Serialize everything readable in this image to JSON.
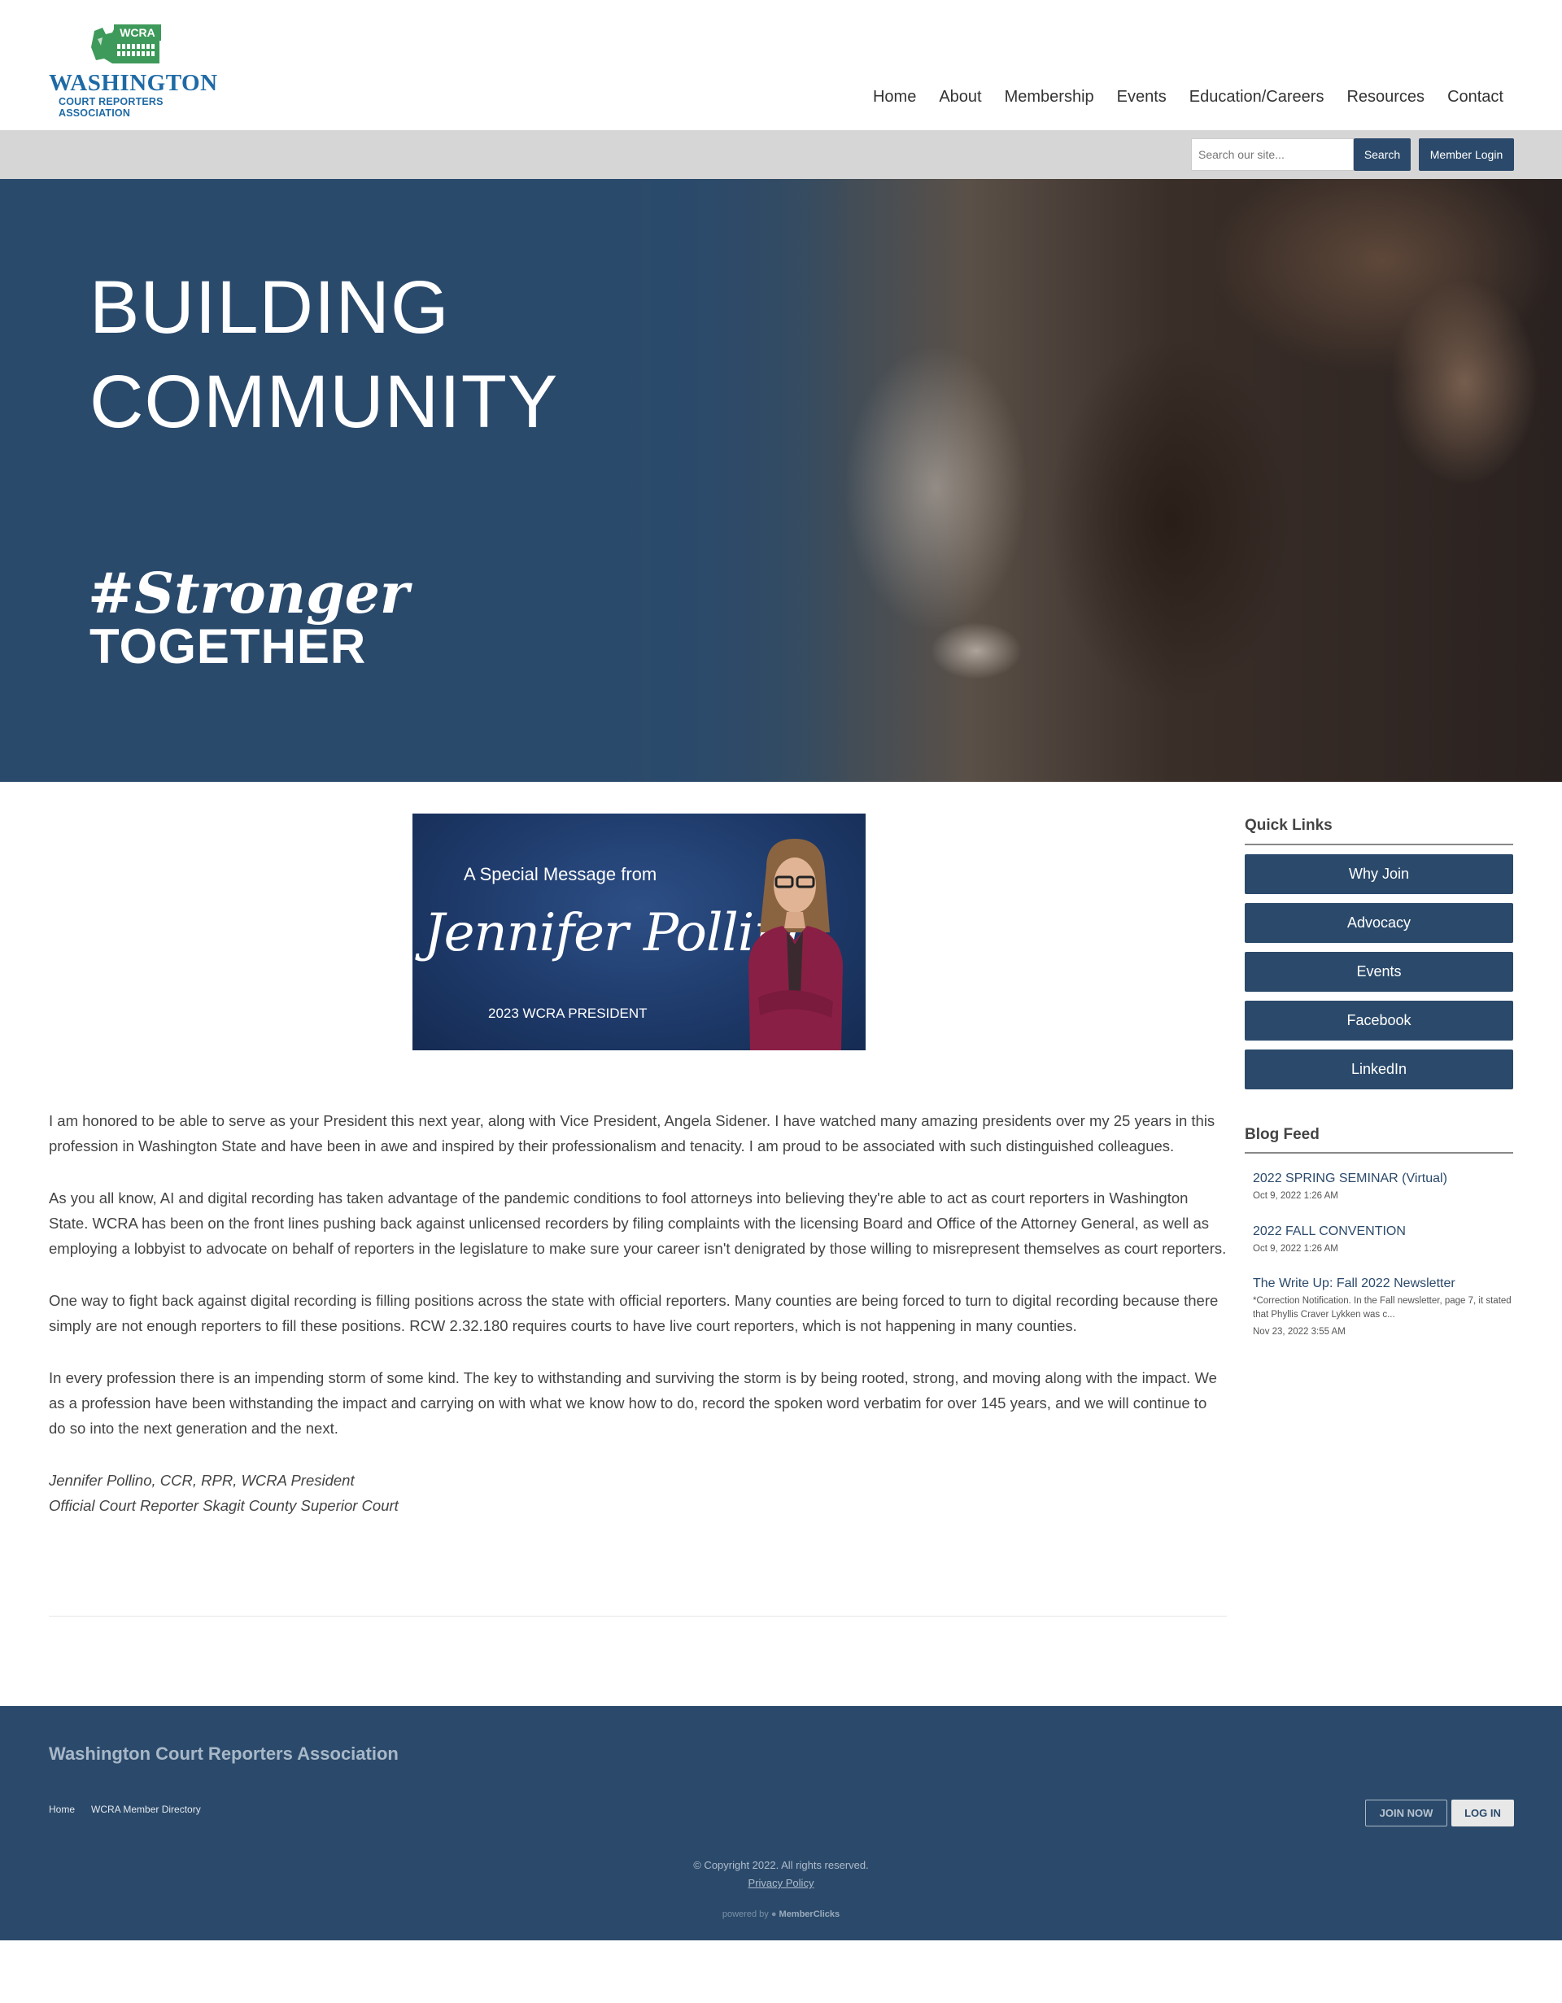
{
  "logo": {
    "badge": "WCRA",
    "name": "WASHINGTON",
    "subtitle": "COURT REPORTERS ASSOCIATION"
  },
  "nav": [
    "Home",
    "About",
    "Membership",
    "Events",
    "Education/Careers",
    "Resources",
    "Contact"
  ],
  "utility": {
    "search_placeholder": "Search our site...",
    "search_button": "Search",
    "login_button": "Member Login"
  },
  "hero": {
    "line1": "BUILDING",
    "line2": "COMMUNITY",
    "tag1": "#Stronger",
    "tag2": "TOGETHER"
  },
  "banner": {
    "message": "A Special Message from",
    "signature": "Jennifer Pollino",
    "role": "2023 WCRA PRESIDENT"
  },
  "article": {
    "paragraphs": [
      "I am honored to be able to serve as your President this next year, along with Vice President, Angela Sidener.  I have watched many amazing presidents over my 25 years in this profession in Washington State and have been in awe and inspired by their professionalism and tenacity.  I am proud to be associated with such distinguished colleagues.",
      "As you all know, AI and digital recording has taken advantage of the pandemic conditions to fool attorneys into believing they're able to act as court reporters in Washington State.  WCRA has been on the front lines pushing back against unlicensed recorders by filing complaints with the licensing Board and Office of the Attorney General, as well as employing a lobbyist to advocate on behalf of reporters in the legislature to make sure your career isn't denigrated by those willing to misrepresent themselves as court reporters.",
      "One way to fight back against digital recording is filling positions across the state with official reporters.  Many counties are being forced to turn to digital recording because there simply are not enough reporters to fill these positions.  RCW 2.32.180 requires courts to have live court reporters, which is not happening in many counties.",
      "In every profession there is an impending storm of some kind.  The key to withstanding and surviving the storm is by being rooted, strong, and moving along with the impact.  We as a profession have been withstanding the impact and carrying on with what we know how to do, record the spoken word verbatim for over 145 years, and we will continue to do so into the next generation and the next."
    ],
    "signoff1": "Jennifer Pollino, CCR, RPR, WCRA President",
    "signoff2": "Official Court Reporter Skagit County Superior Court"
  },
  "sidebar": {
    "quick_links_title": "Quick Links",
    "quick_links": [
      "Why Join",
      "Advocacy",
      "Events",
      "Facebook",
      "LinkedIn"
    ],
    "blog_title": "Blog Feed",
    "blog": [
      {
        "title": "2022 SPRING SEMINAR (Virtual)",
        "date": "Oct 9, 2022 1:26 AM",
        "excerpt": ""
      },
      {
        "title": "2022 FALL CONVENTION",
        "date": "Oct 9, 2022 1:26 AM",
        "excerpt": ""
      },
      {
        "title": "The Write Up: Fall 2022 Newsletter",
        "date": "Nov 23, 2022 3:55 AM",
        "excerpt": "*Correction Notification. In the Fall newsletter, page 7, it stated that Phyllis Craver Lykken was c..."
      }
    ]
  },
  "footer": {
    "title": "Washington Court Reporters Association",
    "links": [
      "Home",
      "WCRA Member Directory"
    ],
    "join_button": "JOIN NOW",
    "login_button": "LOG IN",
    "copyright": "© Copyright 2022.  All rights reserved.",
    "privacy": "Privacy Policy",
    "powered_prefix": "powered by",
    "powered_brand": "MemberClicks"
  },
  "colors": {
    "brand_navy": "#2b4a6b",
    "logo_blue": "#1f6aa5",
    "logo_green": "#3e9a5a",
    "utility_bar": "#d6d6d6"
  }
}
